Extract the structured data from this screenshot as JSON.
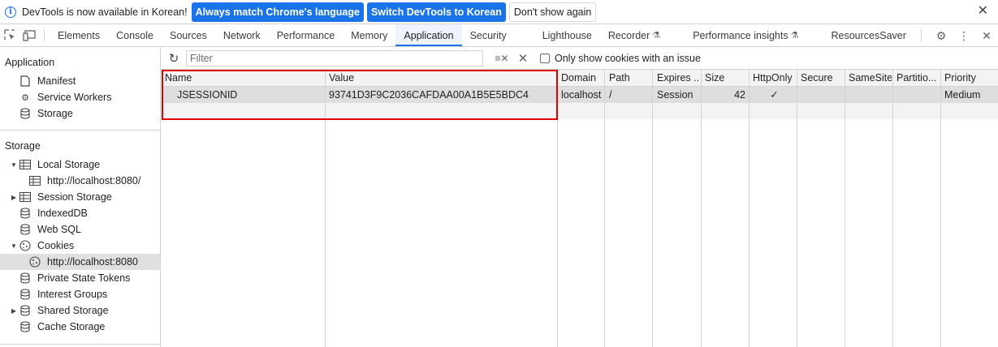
{
  "infobar": {
    "message": "DevTools is now available in Korean!",
    "match_language_label": "Always match Chrome's language",
    "switch_label": "Switch DevTools to Korean",
    "dont_show_label": "Don't show again"
  },
  "tabs": {
    "items": [
      "Elements",
      "Console",
      "Sources",
      "Network",
      "Performance",
      "Memory",
      "Application",
      "Security",
      "Lighthouse",
      "Recorder",
      "Performance insights",
      "ResourcesSaver"
    ],
    "active": "Application"
  },
  "sidebar": {
    "application_header": "Application",
    "application_items": [
      "Manifest",
      "Service Workers",
      "Storage"
    ],
    "storage_header": "Storage",
    "local_storage": "Local Storage",
    "local_storage_origin": "http://localhost:8080/",
    "session_storage": "Session Storage",
    "indexeddb": "IndexedDB",
    "web_sql": "Web SQL",
    "cookies": "Cookies",
    "cookies_origin": "http://localhost:8080",
    "private_state_tokens": "Private State Tokens",
    "interest_groups": "Interest Groups",
    "shared_storage": "Shared Storage",
    "cache_storage": "Cache Storage"
  },
  "toolbar": {
    "filter_placeholder": "Filter",
    "only_issue_label": "Only show cookies with an issue"
  },
  "table": {
    "columns": [
      "Name",
      "Value",
      "Domain",
      "Path",
      "Expires ...",
      "Size",
      "HttpOnly",
      "Secure",
      "SameSite",
      "Partitio...",
      "Priority"
    ],
    "rows": [
      {
        "name": "JSESSIONID",
        "value": "93741D3F9C2036CAFDAA00A1B5E5BDC4",
        "domain": "localhost",
        "path": "/",
        "expires": "Session",
        "size": "42",
        "httponly": "✓",
        "secure": "",
        "samesite": "",
        "partition": "",
        "priority": "Medium"
      }
    ]
  },
  "colors": {
    "accent": "#1a73e8",
    "highlight_border": "#e00000",
    "selected_row": "#dedede"
  }
}
